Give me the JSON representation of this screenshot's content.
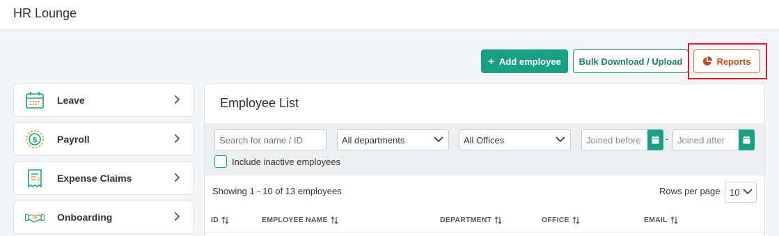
{
  "app": {
    "title": "HR Lounge"
  },
  "actions": {
    "add_employee": "Add employee",
    "bulk": "Bulk Download / Upload",
    "reports": "Reports"
  },
  "sidebar": {
    "items": [
      {
        "label": "Leave",
        "icon": "calendar-icon"
      },
      {
        "label": "Payroll",
        "icon": "dollar-coin-icon"
      },
      {
        "label": "Expense Claims",
        "icon": "receipt-icon"
      },
      {
        "label": "Onboarding",
        "icon": "handshake-icon"
      }
    ]
  },
  "employee_list": {
    "title": "Employee List",
    "search_placeholder": "Search for name / ID",
    "department_selected": "All departments",
    "office_selected": "All Offices",
    "joined_before_placeholder": "Joined before",
    "joined_after_placeholder": "Joined after",
    "date_separator": "-",
    "include_inactive_label": "Include inactive employees",
    "include_inactive_checked": false,
    "showing_text": "Showing 1 - 10 of 13 employees",
    "rows_per_page_label": "Rows per page",
    "rows_per_page_value": "10",
    "columns": [
      "ID",
      "EMPLOYEE NAME",
      "DEPARTMENT",
      "OFFICE",
      "EMAIL"
    ]
  },
  "colors": {
    "primary": "#17a085",
    "reports_accent": "#c24c22",
    "highlight": "#e0192a"
  }
}
